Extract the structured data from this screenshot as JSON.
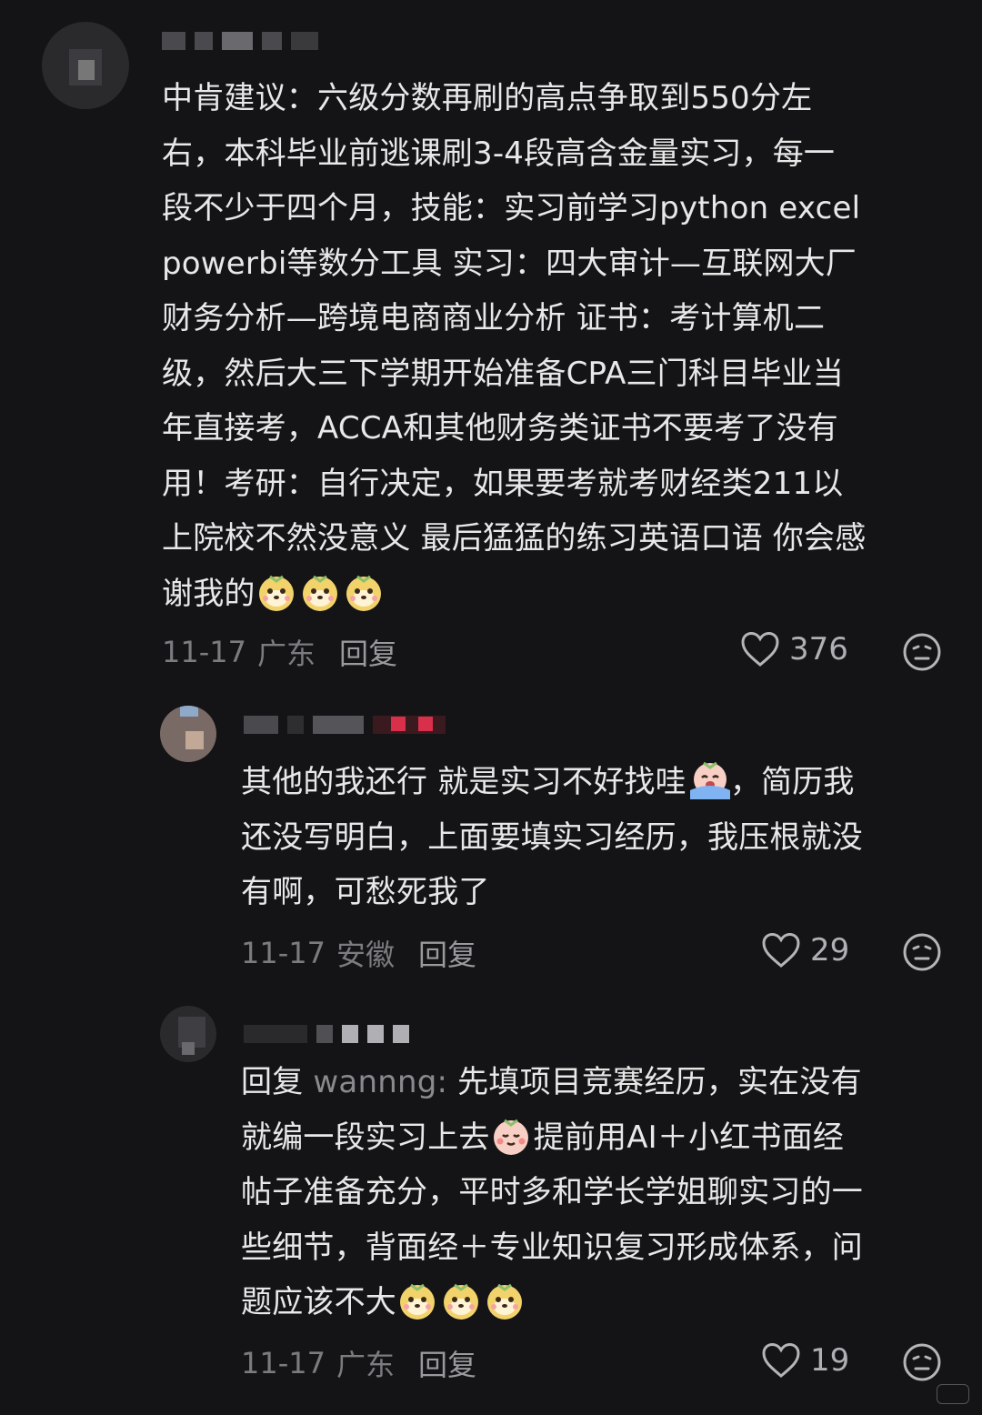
{
  "comments": [
    {
      "lines": [
        "中肯建议：六级分数再刷的高点争取到550分左",
        "右，本科毕业前逃课刷3-4段高含金量实习，每一",
        "段不少于四个月，技能：实习前学习python excel",
        "powerbi等数分工具 实习：四大审计—互联网大厂",
        "财务分析—跨境电商商业分析 证书：考计算机二",
        "级，然后大三下学期开始准备CPA三门科目毕业当",
        "年直接考，ACCA和其他财务类证书不要考了没有",
        "用！考研：自行决定，如果要考就考财经类211以",
        "上院校不然没意义 最后猛猛的练习英语口语 你会感",
        "谢我的"
      ],
      "date": "11-17",
      "location": "广东",
      "reply_label": "回复",
      "likes": "376"
    },
    {
      "lines": [
        "其他的我还行 就是实习不好找哇",
        "还没写明白，上面要填实习经历，我压根就没",
        "有啊，可愁死我了"
      ],
      "line1_tail": "，简历我",
      "date": "11-17",
      "location": "安徽",
      "reply_label": "回复",
      "likes": "29"
    },
    {
      "reply_prefix": "回复",
      "reply_user": "wannng:",
      "lines": [
        "先填项目竞赛经历，实在没有",
        "就编一段实习上去",
        "帖子准备充分，平时多和学长学姐聊实习的一",
        "些细节，背面经＋专业知识复习形成体系，问",
        "题应该不大"
      ],
      "line2_tail": "提前用AI＋小红书面经",
      "date": "11-17",
      "location": "广东",
      "reply_label": "回复",
      "likes": "19"
    }
  ],
  "icons": {
    "like": "heart-outline-icon",
    "dislike": "meh-face-icon",
    "emoji": "dog-face-emoji"
  }
}
